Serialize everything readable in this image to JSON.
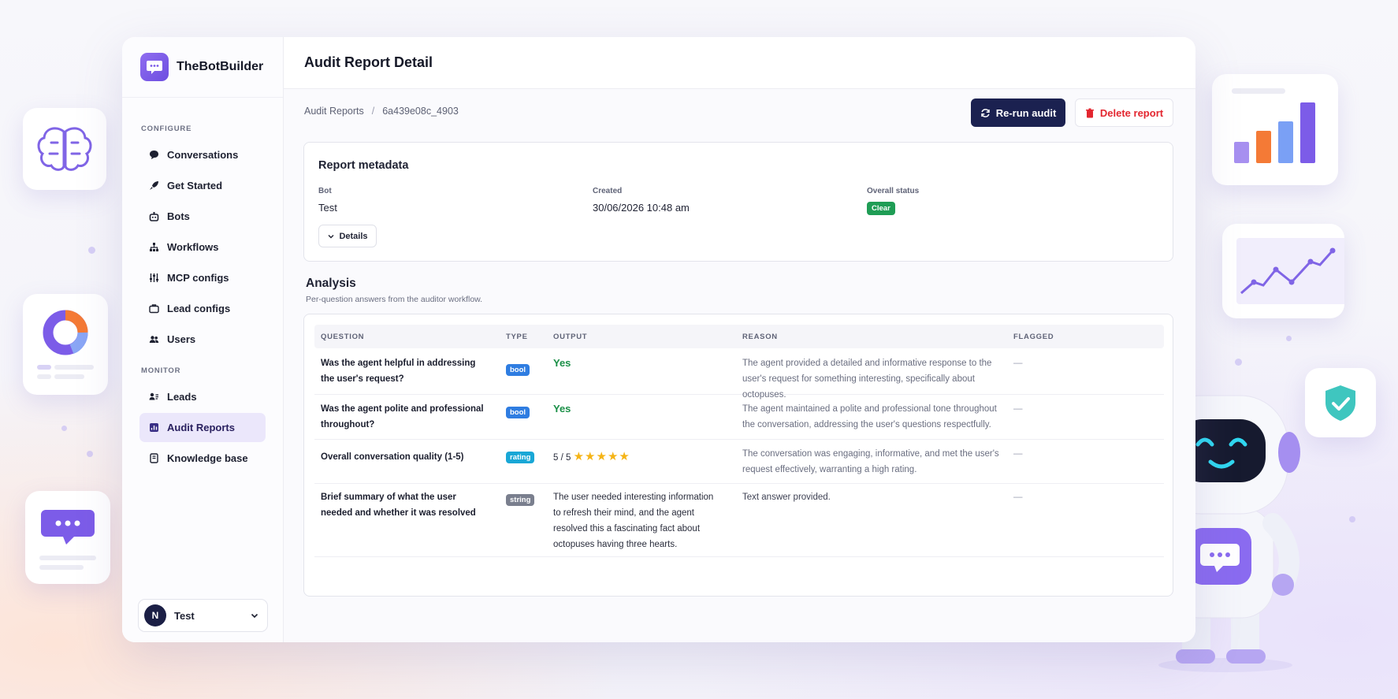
{
  "brand": {
    "name": "TheBotBuilder"
  },
  "sidebar": {
    "sections": [
      {
        "label": "CONFIGURE",
        "items": [
          {
            "label": "Conversations",
            "icon": "chat-bubble-icon"
          },
          {
            "label": "Get Started",
            "icon": "rocket-icon"
          },
          {
            "label": "Bots",
            "icon": "bot-icon"
          },
          {
            "label": "Workflows",
            "icon": "workflow-icon"
          },
          {
            "label": "MCP configs",
            "icon": "sliders-icon"
          },
          {
            "label": "Lead configs",
            "icon": "briefcase-icon"
          },
          {
            "label": "Users",
            "icon": "users-icon"
          }
        ]
      },
      {
        "label": "MONITOR",
        "items": [
          {
            "label": "Leads",
            "icon": "contacts-icon"
          },
          {
            "label": "Audit Reports",
            "icon": "report-icon",
            "active": true
          },
          {
            "label": "Knowledge base",
            "icon": "book-icon"
          }
        ]
      }
    ],
    "user": {
      "initial": "N",
      "name": "Test"
    }
  },
  "page": {
    "title": "Audit Report Detail"
  },
  "breadcrumb": {
    "root": "Audit Reports",
    "separator": "/",
    "current": "6a439e08c_4903"
  },
  "actions": {
    "rerun": "Re-run audit",
    "delete": "Delete report"
  },
  "metadata": {
    "title": "Report metadata",
    "bot_label": "Bot",
    "bot_value": "Test",
    "created_label": "Created",
    "created_value": "30/06/2026 10:48 am",
    "status_label": "Overall status",
    "status_value": "Clear",
    "details_button": "Details"
  },
  "analysis": {
    "title": "Analysis",
    "subtitle": "Per-question answers from the auditor workflow.",
    "columns": [
      "QUESTION",
      "TYPE",
      "OUTPUT",
      "REASON",
      "FLAGGED"
    ],
    "rows": [
      {
        "question": "Was the agent helpful in addressing the user's request?",
        "type": "bool",
        "output": "Yes",
        "reason": "The agent provided a detailed and informative response to the user's request for something interesting, specifically about octopuses.",
        "flagged": "—"
      },
      {
        "question": "Was the agent polite and professional throughout?",
        "type": "bool",
        "output": "Yes",
        "reason": "The agent maintained a polite and professional tone throughout the conversation, addressing the user's questions respectfully.",
        "flagged": "—"
      },
      {
        "question": "Overall conversation quality (1-5)",
        "type": "rating",
        "output": "5 / 5",
        "rating": 5,
        "rating_max": 5,
        "reason": "The conversation was engaging, informative, and met the user's request effectively, warranting a high rating.",
        "flagged": "—"
      },
      {
        "question": "Brief summary of what the user needed and whether it was resolved",
        "type": "string",
        "output": "The user needed interesting information to refresh their mind, and the agent resolved this a fascinating fact about octopuses having three hearts.",
        "reason": "Text answer provided.",
        "flagged": "—"
      }
    ]
  },
  "colors": {
    "accent": "#7c5ce8",
    "navy": "#1b2150",
    "danger": "#e3262f",
    "success": "#1f9d55",
    "tag_bool": "#2f7de1",
    "tag_rating": "#19a7d6",
    "tag_string": "#7a7f8e",
    "star": "#f5b416"
  }
}
